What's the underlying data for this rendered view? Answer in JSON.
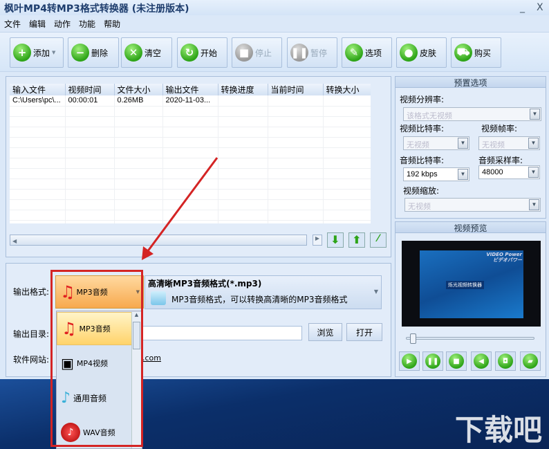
{
  "window": {
    "title": "枫叶MP4转MP3格式转换器  (未注册版本)",
    "minimize": "_",
    "close": "X"
  },
  "menu": [
    "文件",
    "编辑",
    "动作",
    "功能",
    "帮助"
  ],
  "toolbar": [
    {
      "label": "添加",
      "icon": "+",
      "enabled": true
    },
    {
      "label": "删除",
      "icon": "−",
      "enabled": true
    },
    {
      "label": "清空",
      "icon": "✕",
      "enabled": true
    },
    {
      "label": "开始",
      "icon": "↻",
      "enabled": true
    },
    {
      "label": "停止",
      "icon": "■",
      "enabled": false
    },
    {
      "label": "暂停",
      "icon": "❚❚",
      "enabled": false
    },
    {
      "label": "选项",
      "icon": "✎",
      "enabled": true
    },
    {
      "label": "皮肤",
      "icon": "●",
      "enabled": true
    },
    {
      "label": "购买",
      "icon": "⛟",
      "enabled": true
    }
  ],
  "table": {
    "columns": [
      "输入文件",
      "视频时间",
      "文件大小",
      "输出文件",
      "转换进度",
      "当前时间",
      "转换大小"
    ],
    "rows": [
      [
        "C:\\Users\\pc\\...",
        "00:00:01",
        "0.26MB",
        "2020-11-03...",
        "",
        "",
        ""
      ]
    ]
  },
  "output": {
    "format_label": "输出格式:",
    "format_value": "MP3音频",
    "format_desc_title": "高清晰MP3音频格式(*.mp3)",
    "format_desc": "MP3音频格式，可以转换高清晰的MP3音频格式",
    "dir_label": "输出目录:",
    "browse": "浏览",
    "open": "打开",
    "website_label": "软件网站:",
    "website": ".com"
  },
  "format_list": [
    "MP3音频",
    "MP4视频",
    "通用音频",
    "WAV音频"
  ],
  "preset": {
    "title": "预置选项",
    "resolution_label": "视频分辨率:",
    "resolution": "该格式无视频",
    "vbitrate_label": "视频比特率:",
    "vbitrate": "无视频",
    "framerate_label": "视频帧率:",
    "framerate": "无视频",
    "abitrate_label": "音频比特率:",
    "abitrate": "192 kbps",
    "samplerate_label": "音频采样率:",
    "samplerate": "48000",
    "scale_label": "视频缩放:",
    "scale": "无视频"
  },
  "preview": {
    "title": "视频预览",
    "brand": "VIDEO Power",
    "brand_jp": "ビデオパワー",
    "app": "烁光视频转换器",
    "seek": 0.03
  },
  "watermark": "下载吧"
}
